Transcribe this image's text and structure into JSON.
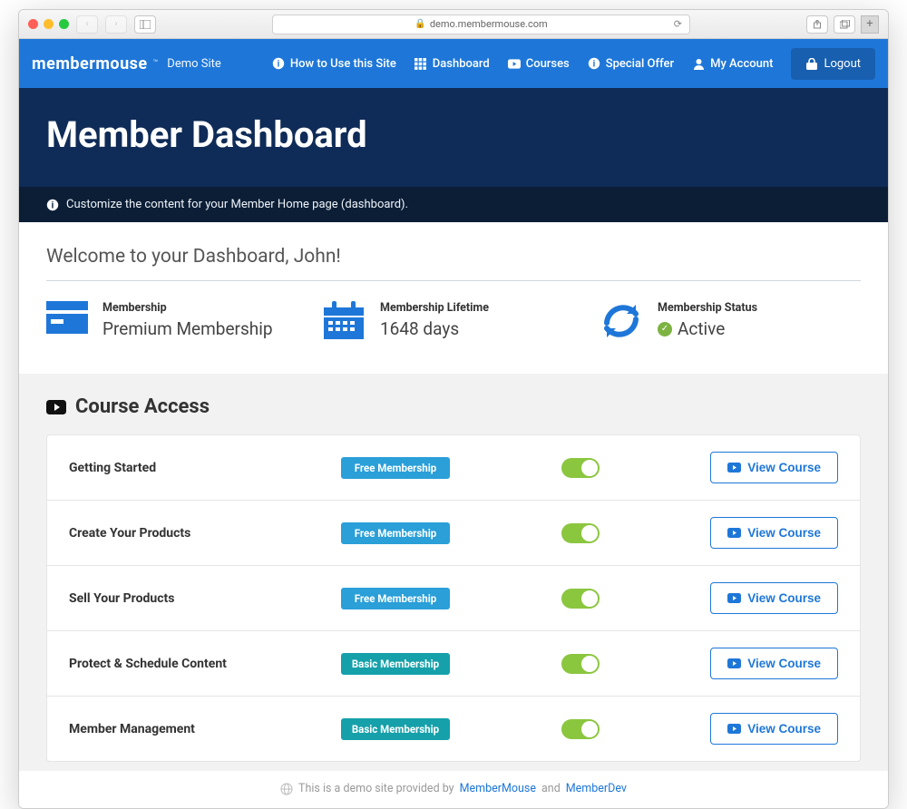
{
  "browser": {
    "url": "demo.membermouse.com"
  },
  "brand": {
    "logo_text": "membermouse",
    "tm": "™",
    "sub": "Demo Site"
  },
  "nav": {
    "how_to": "How to Use this Site",
    "dashboard": "Dashboard",
    "courses": "Courses",
    "special_offer": "Special Offer",
    "my_account": "My Account",
    "logout": "Logout"
  },
  "hero": {
    "title": "Member Dashboard"
  },
  "subbar": {
    "text": "Customize the content for your Member Home page (dashboard)."
  },
  "welcome": {
    "text": "Welcome to your Dashboard, John!"
  },
  "stats": {
    "membership": {
      "label": "Membership",
      "value": "Premium Membership"
    },
    "lifetime": {
      "label": "Membership Lifetime",
      "value": "1648 days"
    },
    "status": {
      "label": "Membership Status",
      "value": "Active"
    }
  },
  "courses": {
    "section_title": "Course Access",
    "view_label": "View Course",
    "items": [
      {
        "name": "Getting Started",
        "tier": "Free Membership",
        "tier_class": "free"
      },
      {
        "name": "Create Your Products",
        "tier": "Free Membership",
        "tier_class": "free"
      },
      {
        "name": "Sell Your Products",
        "tier": "Free Membership",
        "tier_class": "free"
      },
      {
        "name": "Protect & Schedule Content",
        "tier": "Basic Membership",
        "tier_class": "basic"
      },
      {
        "name": "Member Management",
        "tier": "Basic Membership",
        "tier_class": "basic"
      }
    ]
  },
  "footer": {
    "prefix": "This is a demo site provided by ",
    "link1": "MemberMouse",
    "mid": " and ",
    "link2": "MemberDev"
  }
}
